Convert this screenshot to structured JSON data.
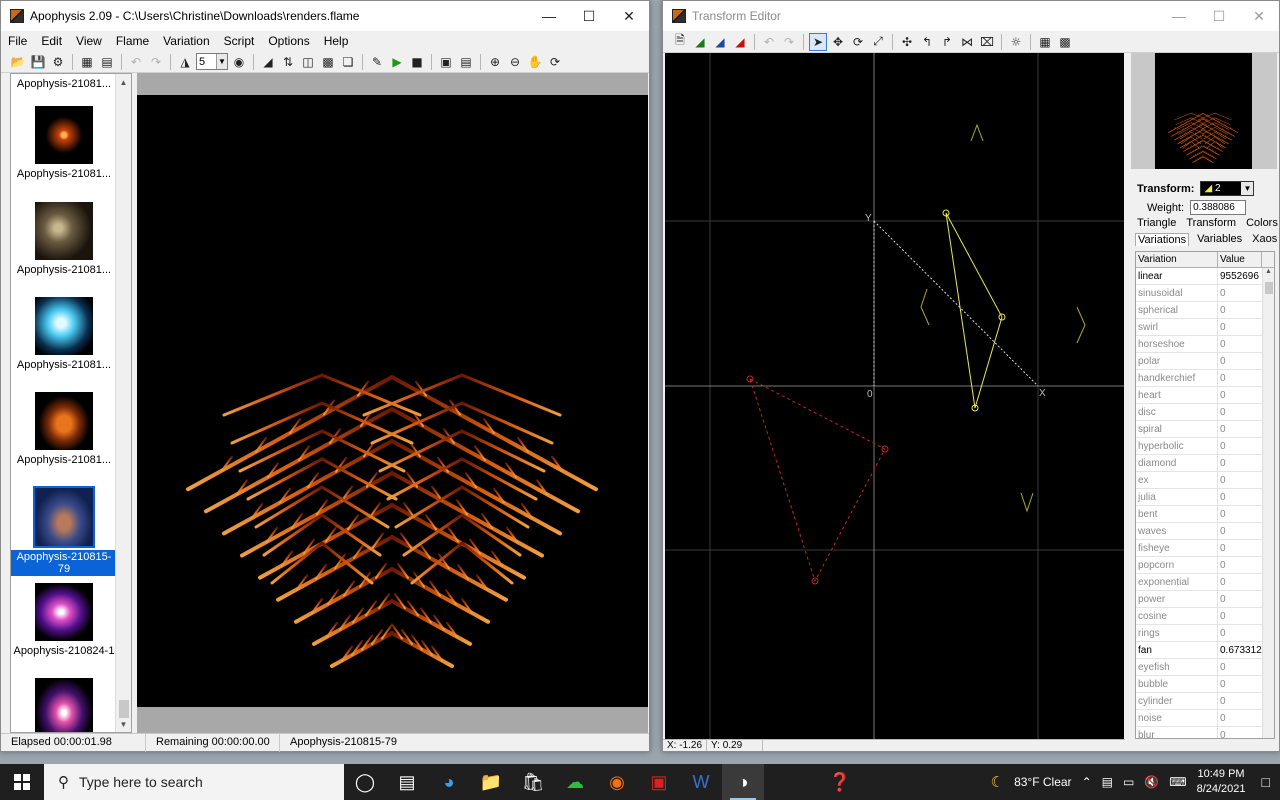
{
  "apophysis": {
    "title": "Apophysis 2.09 - C:\\Users\\Christine\\Downloads\\renders.flame",
    "menu": [
      "File",
      "Edit",
      "View",
      "Flame",
      "Variation",
      "Script",
      "Options",
      "Help"
    ],
    "toolbar_combo": "5",
    "thumbnails": [
      {
        "label": "Apophysis-21081...",
        "style": "partial"
      },
      {
        "label": "Apophysis-21081...",
        "style": "spark"
      },
      {
        "label": "Apophysis-21081...",
        "style": "dust"
      },
      {
        "label": "Apophysis-21081...",
        "style": "ice"
      },
      {
        "label": "Apophysis-21081...",
        "style": "fern"
      },
      {
        "label": "Apophysis-210815-79",
        "style": "fern-blue",
        "selected": true
      },
      {
        "label": "Apophysis-210824-1",
        "style": "pink"
      },
      {
        "label": "",
        "style": "pink2"
      }
    ],
    "status": {
      "elapsed": "Elapsed 00:00:01.98",
      "remaining": "Remaining 00:00:00.00",
      "name": "Apophysis-210815-79"
    }
  },
  "editor": {
    "title": "Transform Editor",
    "coords": {
      "x": "X: -1.26",
      "y": "Y: 0.29"
    },
    "transform_label": "Transform:",
    "transform_value": "2",
    "weight_label": "Weight:",
    "weight_value": "0.388086",
    "tabs_row1": [
      "Triangle",
      "Transform",
      "Colors"
    ],
    "tabs_row2": [
      "Variations",
      "Variables",
      "Xaos"
    ],
    "var_headers": [
      "Variation",
      "Value"
    ],
    "variations": [
      {
        "name": "linear",
        "value": "9552696",
        "active": true
      },
      {
        "name": "sinusoidal",
        "value": "0"
      },
      {
        "name": "spherical",
        "value": "0"
      },
      {
        "name": "swirl",
        "value": "0"
      },
      {
        "name": "horseshoe",
        "value": "0"
      },
      {
        "name": "polar",
        "value": "0"
      },
      {
        "name": "handkerchief",
        "value": "0"
      },
      {
        "name": "heart",
        "value": "0"
      },
      {
        "name": "disc",
        "value": "0"
      },
      {
        "name": "spiral",
        "value": "0"
      },
      {
        "name": "hyperbolic",
        "value": "0"
      },
      {
        "name": "diamond",
        "value": "0"
      },
      {
        "name": "ex",
        "value": "0"
      },
      {
        "name": "julia",
        "value": "0"
      },
      {
        "name": "bent",
        "value": "0"
      },
      {
        "name": "waves",
        "value": "0"
      },
      {
        "name": "fisheye",
        "value": "0"
      },
      {
        "name": "popcorn",
        "value": "0"
      },
      {
        "name": "exponential",
        "value": "0"
      },
      {
        "name": "power",
        "value": "0"
      },
      {
        "name": "cosine",
        "value": "0"
      },
      {
        "name": "rings",
        "value": "0"
      },
      {
        "name": "fan",
        "value": "0.673312",
        "active": true
      },
      {
        "name": "eyefish",
        "value": "0"
      },
      {
        "name": "bubble",
        "value": "0"
      },
      {
        "name": "cylinder",
        "value": "0"
      },
      {
        "name": "noise",
        "value": "0"
      },
      {
        "name": "blur",
        "value": "0"
      }
    ],
    "grid_labels": {
      "y": "Y",
      "x": "X",
      "origin": "0"
    }
  },
  "taskbar": {
    "search_placeholder": "Type here to search",
    "weather": "83°F  Clear",
    "time": "10:49 PM",
    "date": "8/24/2021"
  }
}
